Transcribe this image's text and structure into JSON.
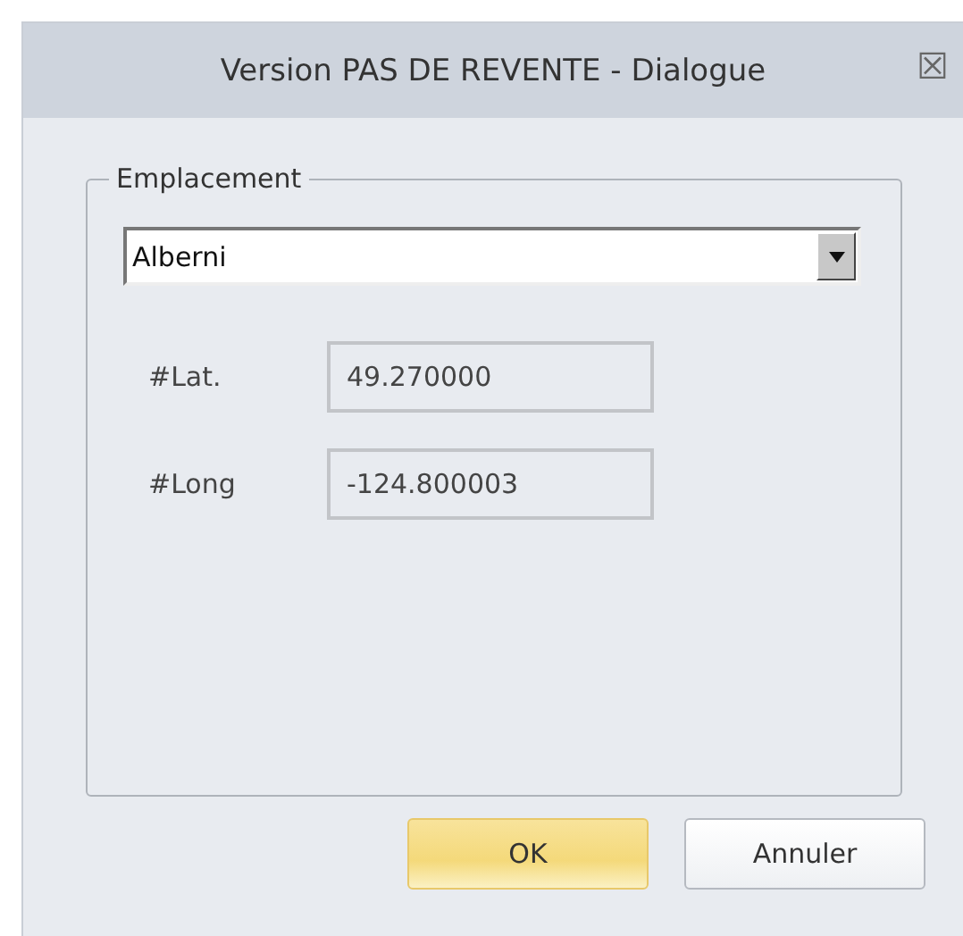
{
  "window": {
    "title": "Version PAS DE REVENTE - Dialogue",
    "close": "☒"
  },
  "group": {
    "legend": "Emplacement",
    "location": {
      "value": "Alberni"
    },
    "fields": [
      {
        "label": "#Lat.",
        "value": "49.270000"
      },
      {
        "label": "#Long",
        "value": "-124.800003"
      }
    ]
  },
  "buttons": [
    {
      "label": "OK",
      "default": true
    },
    {
      "label": "Annuler",
      "default": false
    }
  ]
}
